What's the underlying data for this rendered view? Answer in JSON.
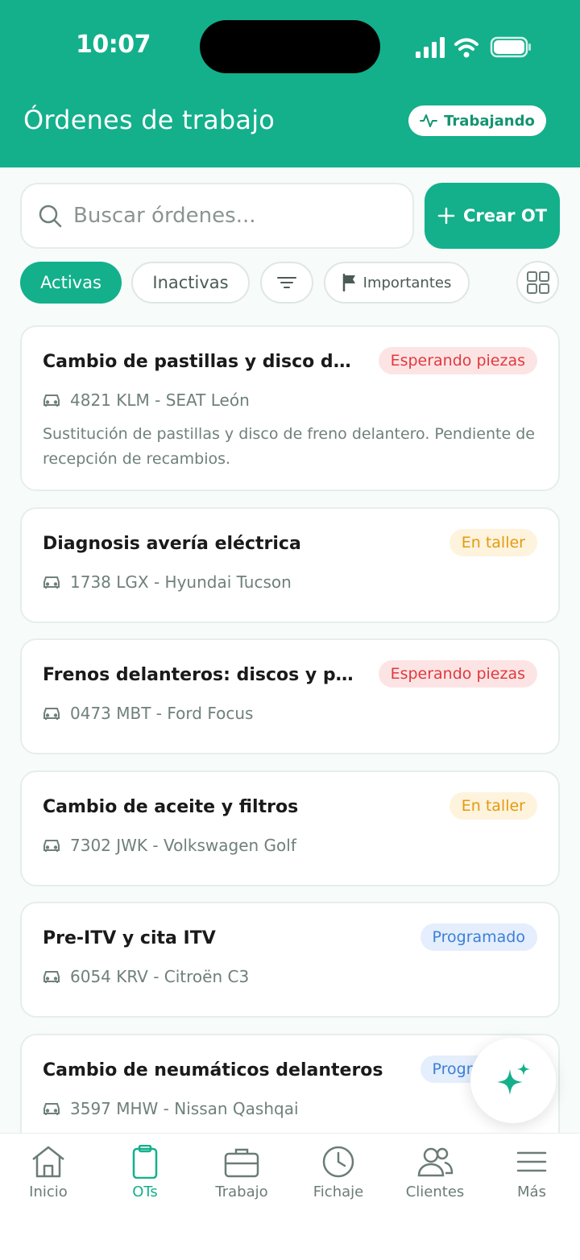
{
  "status_bar": {
    "time": "10:07"
  },
  "header": {
    "title": "Órdenes de trabajo",
    "work_status": "Trabajando"
  },
  "search": {
    "placeholder": "Buscar órdenes...",
    "value": ""
  },
  "create_button": {
    "label": "Crear OT"
  },
  "filters": {
    "active": "Activas",
    "inactive": "Inactivas",
    "important": "Importantes"
  },
  "orders": [
    {
      "title": "Cambio de pastillas y disco de...",
      "status": "Esperando piezas",
      "status_kind": "red",
      "vehicle": "4821 KLM - SEAT León",
      "description": "Sustitución de pastillas y disco de freno delantero. Pendiente de recepción de recambios."
    },
    {
      "title": "Diagnosis avería eléctrica",
      "status": "En taller",
      "status_kind": "orange",
      "vehicle": "1738 LGX - Hyundai Tucson",
      "description": ""
    },
    {
      "title": "Frenos delanteros: discos y pa...",
      "status": "Esperando piezas",
      "status_kind": "red",
      "vehicle": "0473 MBT - Ford Focus",
      "description": ""
    },
    {
      "title": "Cambio de aceite y filtros",
      "status": "En taller",
      "status_kind": "orange",
      "vehicle": "7302 JWK - Volkswagen Golf",
      "description": ""
    },
    {
      "title": "Pre-ITV y cita ITV",
      "status": "Programado",
      "status_kind": "blue",
      "vehicle": "6054 KRV - Citroën C3",
      "description": ""
    },
    {
      "title": "Cambio de neumáticos delanteros",
      "status": "Programado",
      "status_kind": "blue",
      "vehicle": "3597 MHW - Nissan Qashqai",
      "description": ""
    }
  ],
  "tabbar": {
    "items": [
      {
        "label": "Inicio",
        "icon": "home-icon"
      },
      {
        "label": "OTs",
        "icon": "clipboard-icon",
        "active": true
      },
      {
        "label": "Trabajo",
        "icon": "briefcase-icon"
      },
      {
        "label": "Fichaje",
        "icon": "clock-icon"
      },
      {
        "label": "Clientes",
        "icon": "users-icon"
      },
      {
        "label": "Más",
        "icon": "menu-icon"
      }
    ]
  },
  "colors": {
    "brand": "#13b08b",
    "red": "#e0393e",
    "orange": "#e39a0f",
    "blue": "#3b7fd8"
  }
}
